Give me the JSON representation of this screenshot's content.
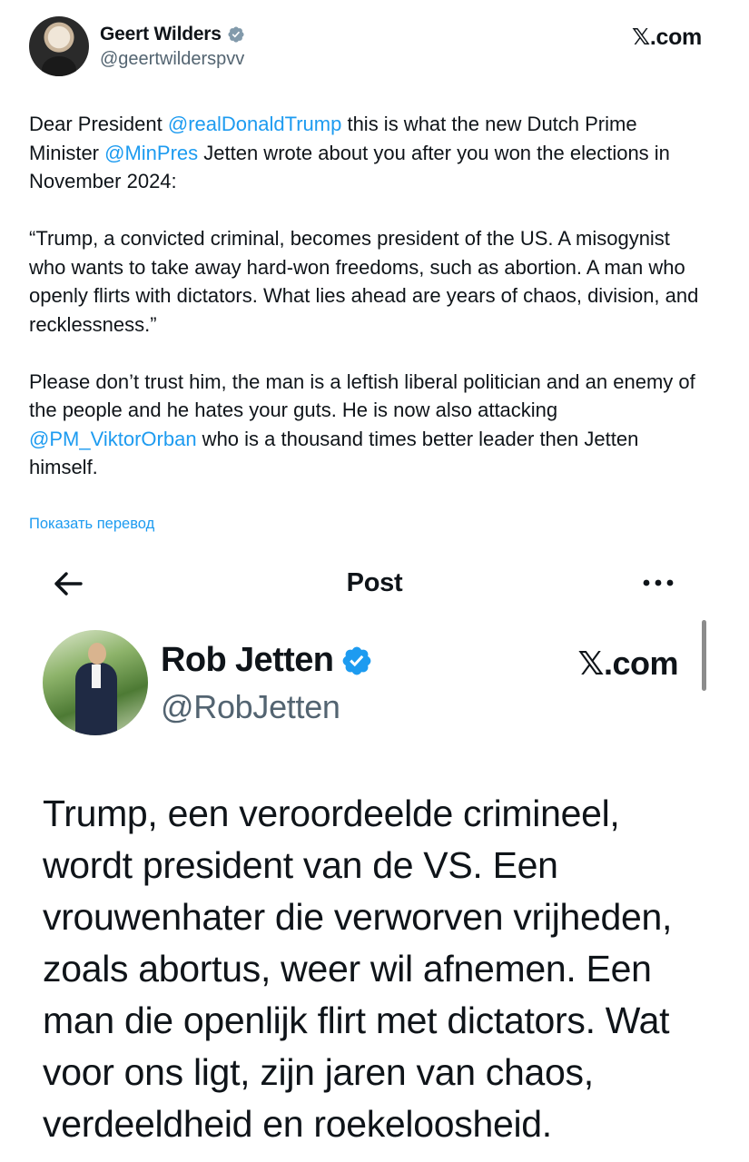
{
  "top_tweet": {
    "author_name": "Geert Wilders",
    "author_handle": "@geertwilderspvv",
    "source_label": "𝕏.com",
    "paragraph1_pre": "Dear President ",
    "mention1": "@realDonaldTrump",
    "paragraph1_mid": " this is what the new Dutch Prime Minister ",
    "mention2": "@MinPres",
    "paragraph1_post": " Jetten wrote about you after you won the elections in November 2024:",
    "paragraph2": "“Trump, a convicted criminal, becomes president of the US. A misogynist who wants to take away hard-won freedoms, such as abortion. A man who openly flirts with dictators. What lies ahead are years of chaos, division, and recklessness.”",
    "paragraph3_pre": "Please don’t trust him, the man is a leftish liberal politician and an enemy of the people and he hates your guts. He is now also attacking ",
    "mention3": "@PM_ViktorOrban",
    "paragraph3_post": " who is a thousand times better leader then Jetten himself.",
    "translate_link": "Показать перевод",
    "badge_color": "#829aab",
    "link_color": "#1d9bf0"
  },
  "screenshot": {
    "header_title": "Post",
    "author_name": "Rob Jetten",
    "author_handle": "@RobJetten",
    "source_label": "𝕏.com",
    "text": "Trump, een veroordeelde crimineel, wordt president van de VS. Een vrouwenhater die verworven vrijheden, zoals abortus, weer wil afnemen. Een man die openlijk flirt met dictators. Wat voor ons ligt, zijn jaren van chaos, verdeeldheid en roekeloosheid.",
    "badge_color": "#1d9bf0"
  }
}
